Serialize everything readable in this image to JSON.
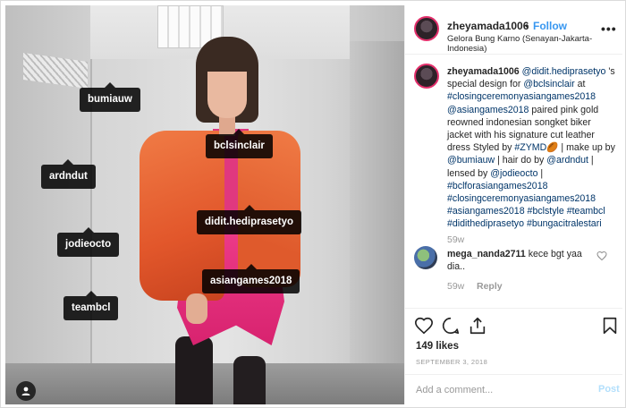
{
  "post": {
    "username": "zheyamada1006",
    "follow_label": "Follow",
    "separator": "•",
    "location": "Gelora Bung Karno (Senayan-Jakarta-Indonesia)",
    "more_label": "•••"
  },
  "photo": {
    "tags": [
      "bumiauw",
      "bclsinclair",
      "ardndut",
      "didit.hediprasetyo",
      "jodieocto",
      "asiangames2018",
      "teambcl"
    ]
  },
  "caption": {
    "username": "zheyamada1006",
    "segments": [
      {
        "t": "@didit.hediprasetyo",
        "link": true
      },
      {
        "t": " 's special design for ",
        "link": false
      },
      {
        "t": "@bclsinclair",
        "link": true
      },
      {
        "t": " at ",
        "link": false
      },
      {
        "t": "#closingceremonyasiangames2018",
        "link": true
      },
      {
        "t": " ",
        "link": false
      },
      {
        "t": "@asiangames2018",
        "link": true
      },
      {
        "t": " paired pink gold reowned indonesian songket biker jacket with his signature cut leather dress Styled by ",
        "link": false
      },
      {
        "t": "#ZYMD",
        "link": true
      },
      {
        "t": "🏉 | make up by ",
        "link": false
      },
      {
        "t": "@bumiauw",
        "link": true
      },
      {
        "t": " | hair do by ",
        "link": false
      },
      {
        "t": "@ardndut",
        "link": true
      },
      {
        "t": " | lensed by ",
        "link": false
      },
      {
        "t": "@jodieocto",
        "link": true
      },
      {
        "t": " | ",
        "link": false
      },
      {
        "t": "#bclforasiangames2018",
        "link": true
      },
      {
        "t": " ",
        "link": false
      },
      {
        "t": "#closingceremonyasiangames2018",
        "link": true
      },
      {
        "t": " ",
        "link": false
      },
      {
        "t": "#asiangames2018",
        "link": true
      },
      {
        "t": " ",
        "link": false
      },
      {
        "t": "#bclstyle",
        "link": true
      },
      {
        "t": " ",
        "link": false
      },
      {
        "t": "#teambcl",
        "link": true
      },
      {
        "t": " ",
        "link": false
      },
      {
        "t": "#didithediprasetyo",
        "link": true
      },
      {
        "t": " ",
        "link": false
      },
      {
        "t": "#bungacitralestari",
        "link": true
      }
    ],
    "time": "59w"
  },
  "comment": {
    "username": "mega_nanda2711",
    "text": "kece bgt yaa dia..",
    "time": "59w",
    "reply_label": "Reply"
  },
  "engagement": {
    "likes": "149 likes",
    "date": "SEPTEMBER 3, 2018"
  },
  "add_comment": {
    "placeholder": "Add a comment...",
    "post_label": "Post"
  }
}
